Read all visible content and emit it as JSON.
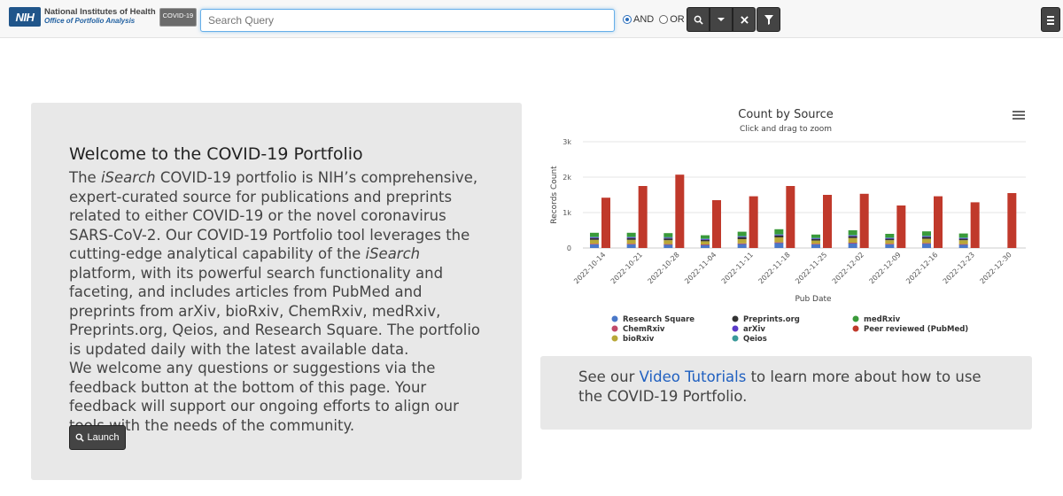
{
  "header": {
    "logo_mark": "NIH",
    "logo_line1": "National Institutes of Health",
    "logo_line2": "Office of Portfolio Analysis",
    "logo_tag": "COVID-19",
    "search_placeholder": "Search Query",
    "radio_and": "AND",
    "radio_or": "OR",
    "selected_operator": "AND"
  },
  "welcome": {
    "title": "Welcome to the COVID-19 Portfolio",
    "p1_a": "The ",
    "p1_isearch1": "iSearch",
    "p1_b": " COVID-19 portfolio is NIH’s comprehensive, expert-curated source for publications and preprints related to either COVID-19 or the novel coronavirus SARS-CoV-2. Our COVID-19 Portfolio tool leverages the cutting-edge analytical capability of the ",
    "p1_isearch2": "iSearch",
    "p1_c": " platform, with its powerful search functionality and faceting, and includes articles from PubMed and preprints from arXiv, bioRxiv, ChemRxiv, medRxiv, Preprints.org, Qeios, and Research Square. The portfolio is updated daily with the latest available data.",
    "p2": "We welcome any questions or suggestions via the feedback button at the bottom of this page. Your feedback will support our ongoing efforts to align our tools with the needs of the community.",
    "launch_label": "Launch"
  },
  "tutorial": {
    "text_a": "See our ",
    "link": "Video Tutorials",
    "text_b": " to learn more about how to use the COVID-19 Portfolio."
  },
  "chart_data": {
    "type": "bar",
    "title": "Count by Source",
    "subtitle": "Click and drag to zoom",
    "xlabel": "Pub Date",
    "ylabel": "Records Count",
    "ylim": [
      0,
      3000
    ],
    "yticks": [
      "0",
      "1k",
      "2k",
      "3k"
    ],
    "ytick_values": [
      0,
      1000,
      2000,
      3000
    ],
    "categories": [
      "2022-10-14",
      "2022-10-21",
      "2022-10-28",
      "2022-11-04",
      "2022-11-11",
      "2022-11-18",
      "2022-11-25",
      "2022-12-02",
      "2022-12-09",
      "2022-12-16",
      "2022-12-23",
      "2022-12-30"
    ],
    "series": [
      {
        "name": "Research Square",
        "color": "#4a78c8",
        "values": [
          110,
          110,
          100,
          90,
          120,
          150,
          110,
          140,
          110,
          130,
          100,
          0
        ]
      },
      {
        "name": "ChemRxiv",
        "color": "#c04a6a",
        "values": [
          10,
          10,
          10,
          10,
          10,
          10,
          10,
          10,
          10,
          10,
          10,
          0
        ]
      },
      {
        "name": "bioRxiv",
        "color": "#b8a838",
        "values": [
          110,
          110,
          110,
          90,
          120,
          140,
          90,
          130,
          100,
          120,
          110,
          0
        ]
      },
      {
        "name": "Preprints.org",
        "color": "#333333",
        "values": [
          50,
          50,
          50,
          40,
          50,
          50,
          40,
          50,
          40,
          50,
          40,
          0
        ]
      },
      {
        "name": "arXiv",
        "color": "#5a3ac8",
        "values": [
          20,
          20,
          20,
          20,
          20,
          20,
          20,
          20,
          20,
          20,
          20,
          0
        ]
      },
      {
        "name": "Qeios",
        "color": "#3a9a9a",
        "values": [
          20,
          20,
          20,
          20,
          20,
          20,
          20,
          20,
          20,
          20,
          20,
          0
        ]
      },
      {
        "name": "medRxiv",
        "color": "#3a9a3a",
        "values": [
          110,
          110,
          110,
          90,
          120,
          140,
          90,
          130,
          100,
          120,
          110,
          0
        ]
      },
      {
        "name": "Peer reviewed (PubMed)",
        "color": "#c0392b",
        "values": [
          1420,
          1750,
          2070,
          1350,
          1460,
          1750,
          1500,
          1530,
          1200,
          1460,
          1290,
          1550
        ]
      }
    ],
    "grid": true,
    "legend": "bottom"
  }
}
